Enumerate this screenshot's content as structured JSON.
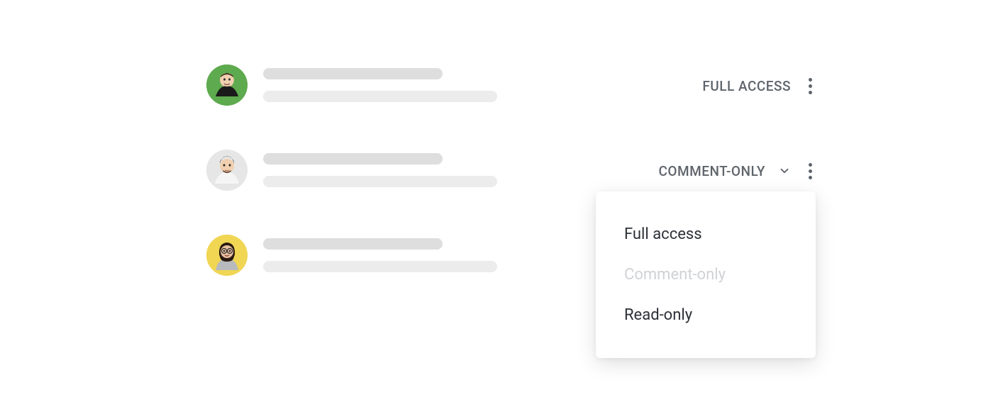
{
  "users": [
    {
      "avatar_bg": "#5eaa4e",
      "access_label": "FULL ACCESS",
      "has_dropdown": false
    },
    {
      "avatar_bg": "#e6e6e6",
      "access_label": "COMMENT-ONLY",
      "has_dropdown": true
    },
    {
      "avatar_bg": "#f0d653",
      "access_label": "",
      "has_dropdown": false
    }
  ],
  "dropdown": {
    "options": [
      {
        "label": "Full access",
        "selected": false
      },
      {
        "label": "Comment-only",
        "selected": true
      },
      {
        "label": "Read-only",
        "selected": false
      }
    ]
  }
}
